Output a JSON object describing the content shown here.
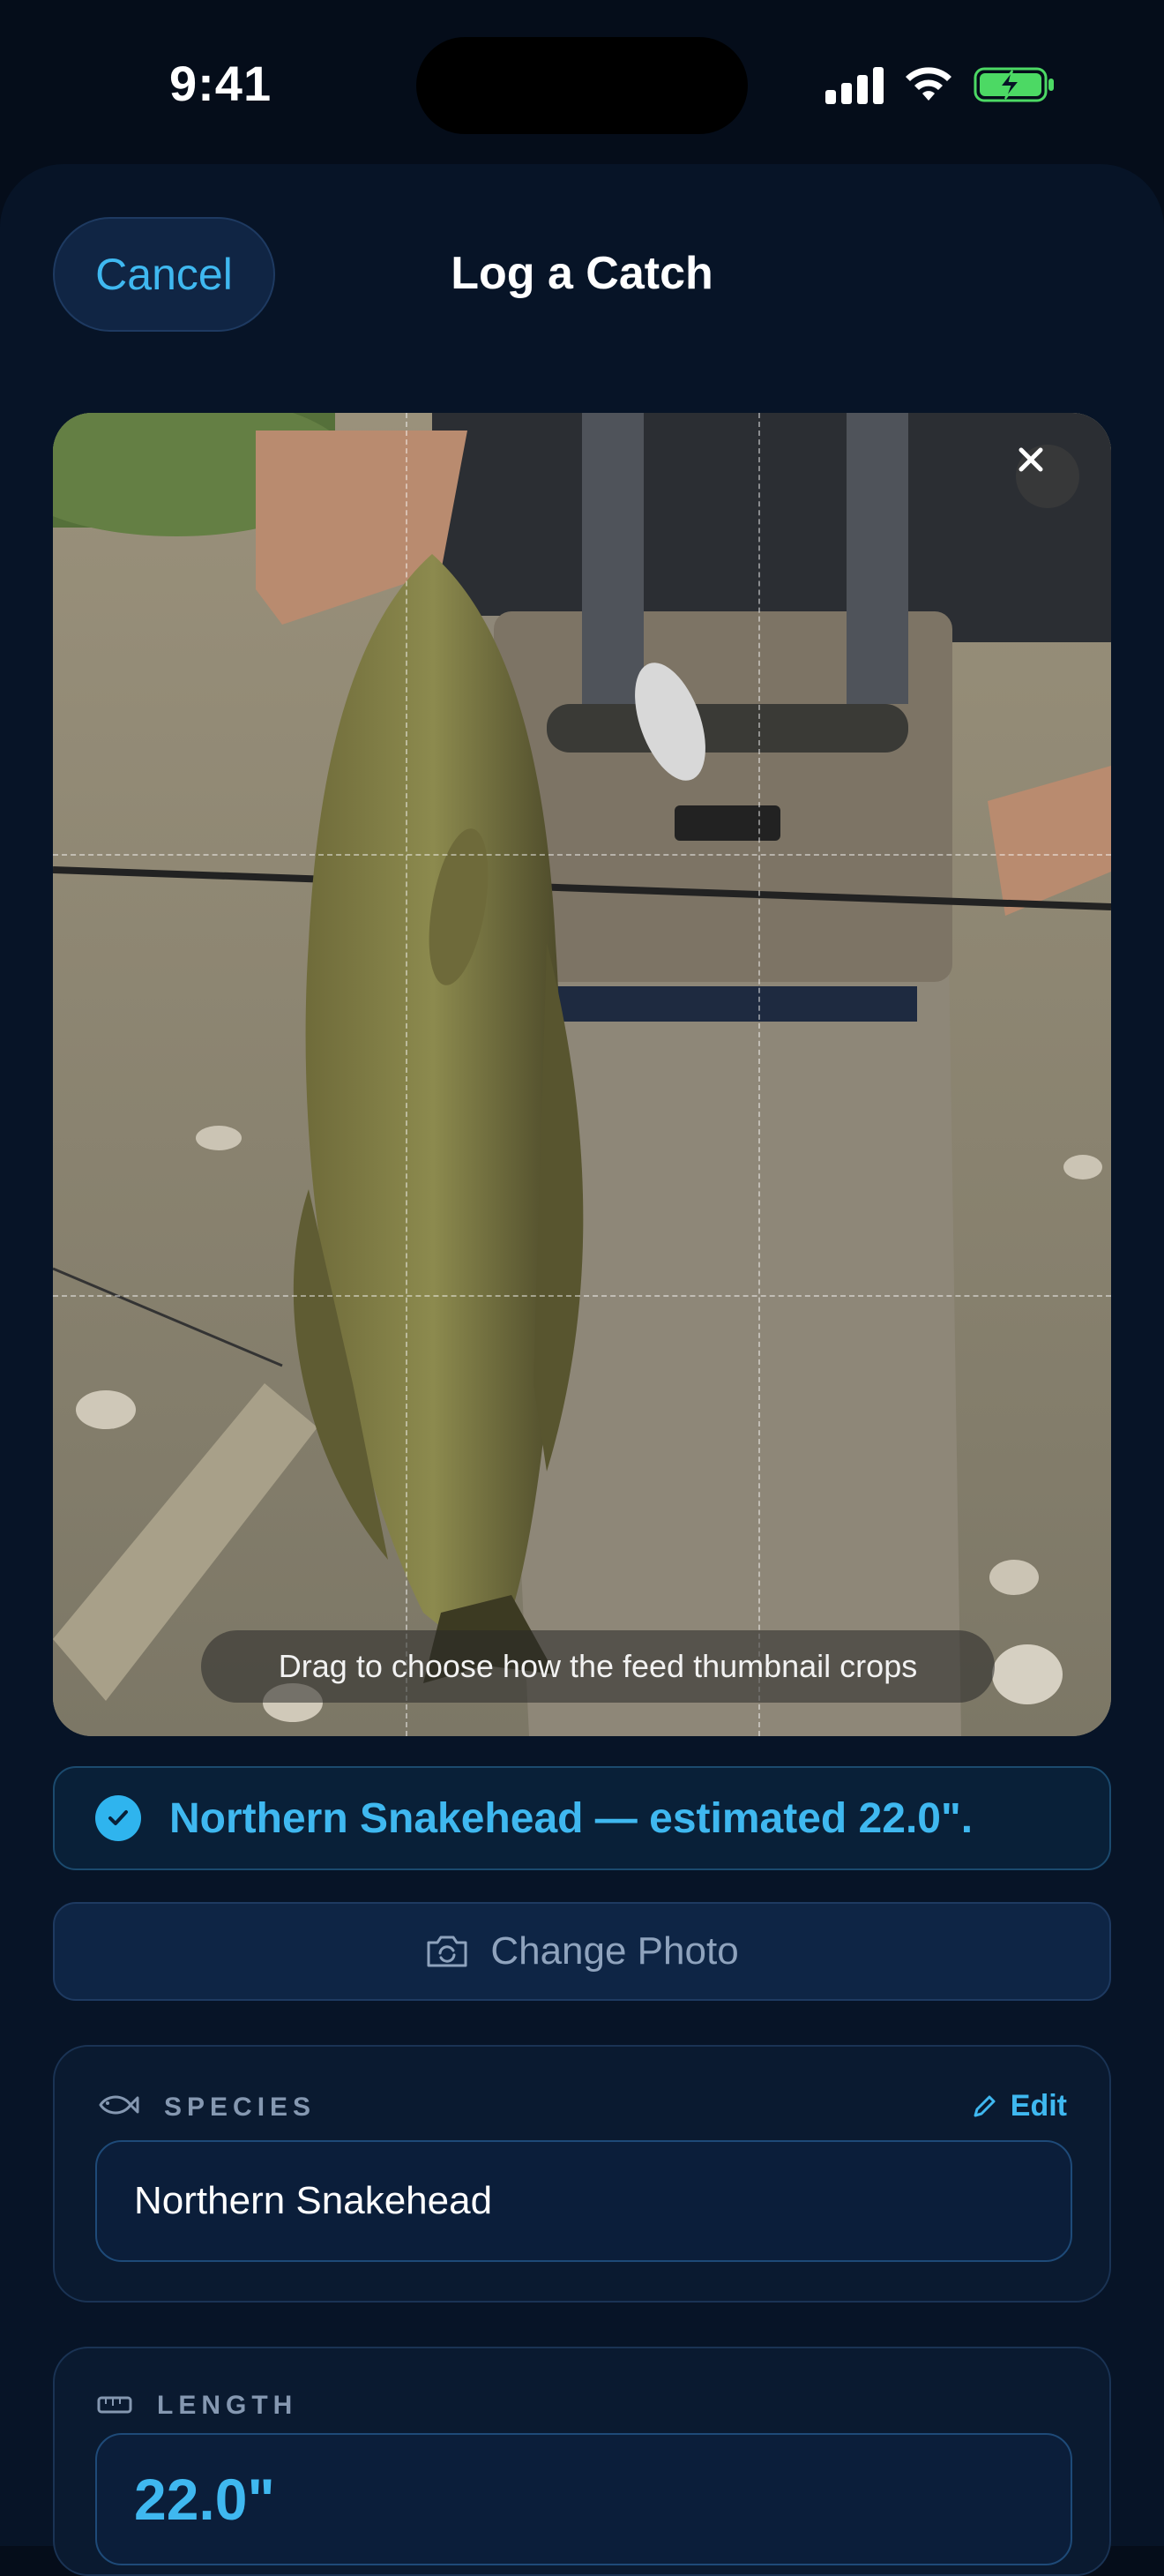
{
  "status_bar": {
    "time": "9:41"
  },
  "header": {
    "cancel_label": "Cancel",
    "title": "Log a Catch"
  },
  "photo": {
    "crop_hint": "Drag to choose how the feed thumbnail crops"
  },
  "detection": {
    "text": "Northern Snakehead — estimated 22.0\"."
  },
  "change_photo_label": "Change Photo",
  "species_card": {
    "label": "SPECIES",
    "edit_label": "Edit",
    "value": "Northern Snakehead"
  },
  "length_card": {
    "label": "LENGTH",
    "value": "22.0\""
  },
  "colors": {
    "accent": "#3fb8f0",
    "background": "#071427",
    "battery": "#4cd964"
  }
}
